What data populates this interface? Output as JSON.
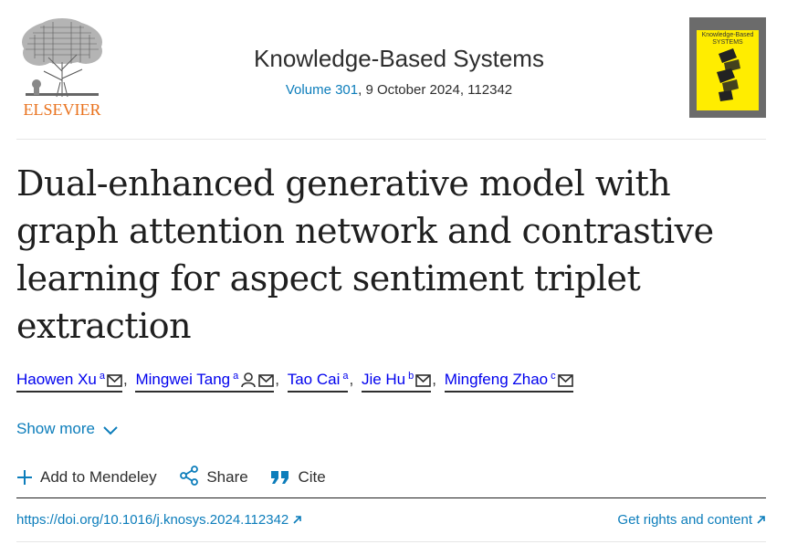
{
  "header": {
    "publisher": "ELSEVIER",
    "journal_title": "Knowledge-Based Systems",
    "volume": "Volume 301",
    "issue_info": ", 9 October 2024, 112342",
    "cover_title": "Knowledge-Based SYSTEMS"
  },
  "article": {
    "title": "Dual-enhanced generative model with graph attention network and contrastive learning for aspect sentiment triplet extraction"
  },
  "authors": [
    {
      "name": "Haowen Xu",
      "aff": "a"
    },
    {
      "name": "Mingwei Tang",
      "aff": "a"
    },
    {
      "name": "Tao Cai",
      "aff": "a"
    },
    {
      "name": "Jie Hu",
      "aff": "b"
    },
    {
      "name": "Mingfeng Zhao",
      "aff": "c"
    }
  ],
  "show_more": "Show more",
  "actions": {
    "mendeley": "Add to Mendeley",
    "share": "Share",
    "cite": "Cite"
  },
  "links": {
    "doi": "https://doi.org/10.1016/j.knosys.2024.112342",
    "rights": "Get rights and content"
  },
  "colors": {
    "link": "#0c7dbb",
    "elsevier_orange": "#e9711c",
    "cover_yellow": "#ffed00"
  }
}
